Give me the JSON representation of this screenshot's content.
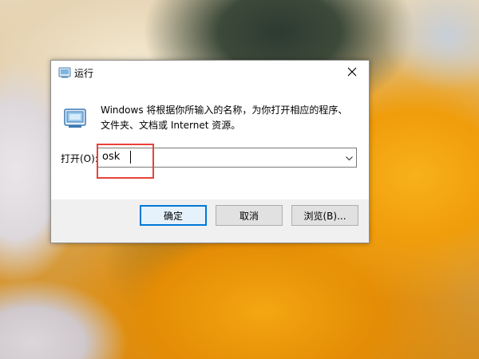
{
  "dialog": {
    "title": "运行",
    "description_line1": "Windows 将根据你所输入的名称，为你打开相应的程序、",
    "description_line2": "文件夹、文档或 Internet 资源。",
    "open_label": "打开(O):",
    "input_value": "osk",
    "buttons": {
      "ok": "确定",
      "cancel": "取消",
      "browse": "浏览(B)..."
    },
    "icons": {
      "title": "run-icon",
      "close": "close-icon",
      "dropdown": "chevron-down-icon"
    }
  },
  "colors": {
    "highlight": "#e8413a",
    "focus": "#0078d7"
  }
}
